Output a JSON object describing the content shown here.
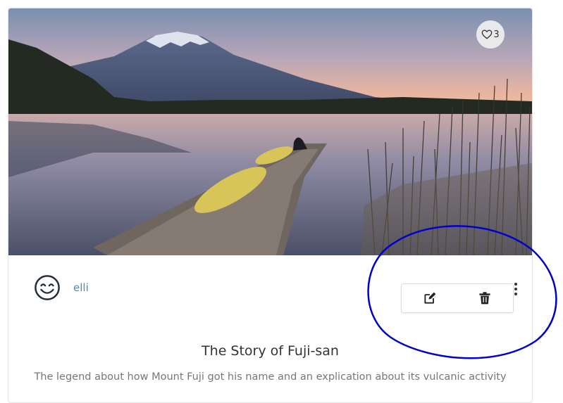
{
  "post": {
    "likes": "3",
    "author": "elli",
    "title": "The Story of Fuji-san",
    "description": "The legend about how Mount Fuji got his name and an explication about its vulcanic activity"
  },
  "icons": {
    "like": "heart-outline-icon",
    "avatar": "smiley-face-icon",
    "more": "vertical-dots-icon",
    "edit": "pencil-square-icon",
    "delete": "trash-can-icon"
  },
  "colors": {
    "author_link": "#3a8fd0",
    "annotation": "#0000cc",
    "border": "#e3e3e3"
  }
}
